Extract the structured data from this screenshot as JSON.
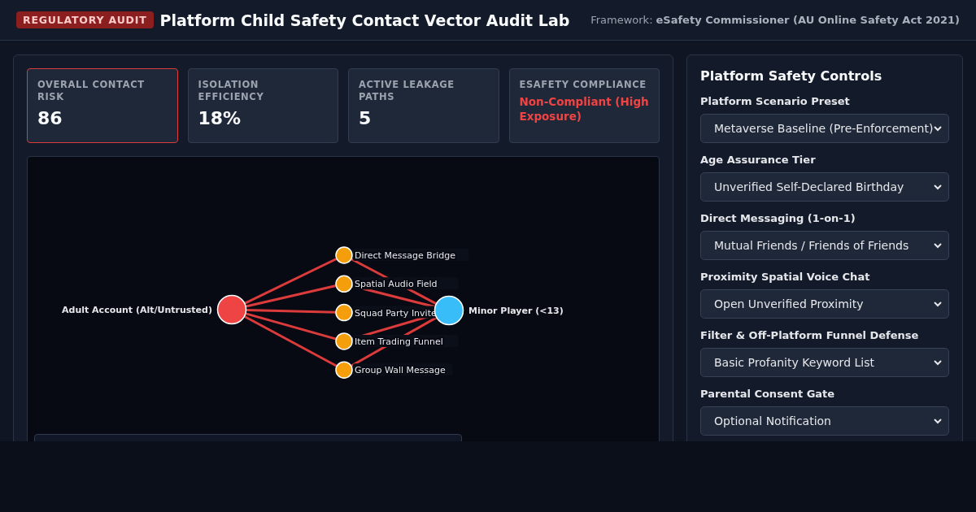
{
  "header": {
    "badge": "REGULATORY AUDIT",
    "title": "Platform Child Safety Contact Vector Audit Lab",
    "framework_label": "Framework:",
    "framework": "eSafety Commissioner (AU Online Safety Act 2021)"
  },
  "metrics": [
    {
      "label": "OVERALL CONTACT RISK",
      "value": "86",
      "highlighted": true,
      "alert": false
    },
    {
      "label": "ISOLATION EFFICIENCY",
      "value": "18%",
      "highlighted": false,
      "alert": false
    },
    {
      "label": "ACTIVE LEAKAGE PATHS",
      "value": "5",
      "highlighted": false,
      "alert": false
    },
    {
      "label": "ESAFETY COMPLIANCE",
      "value": "Non-Compliant (High Exposure)",
      "highlighted": false,
      "alert": true
    }
  ],
  "graph": {
    "source": "Adult Account (Alt/Untrusted)",
    "target": "Minor Player (<13)",
    "vectors": [
      {
        "label": "Direct Message Bridge",
        "open": true
      },
      {
        "label": "Spatial Audio Field",
        "open": true
      },
      {
        "label": "Squad Party Invite",
        "open": true
      },
      {
        "label": "Item Trading Funnel",
        "open": true
      },
      {
        "label": "Group Wall Message",
        "open": true
      }
    ]
  },
  "controls": {
    "title": "Platform Safety Controls",
    "fields": [
      {
        "label": "Platform Scenario Preset",
        "value": "Metaverse Baseline (Pre-Enforcement)"
      },
      {
        "label": "Age Assurance Tier",
        "value": "Unverified Self-Declared Birthday"
      },
      {
        "label": "Direct Messaging (1-on-1)",
        "value": "Mutual Friends / Friends of Friends"
      },
      {
        "label": "Proximity Spatial Voice Chat",
        "value": "Open Unverified Proximity"
      },
      {
        "label": "Filter & Off-Platform Funnel Defense",
        "value": "Basic Profanity Keyword List"
      },
      {
        "label": "Parental Consent Gate",
        "value": "Optional Notification"
      }
    ]
  }
}
